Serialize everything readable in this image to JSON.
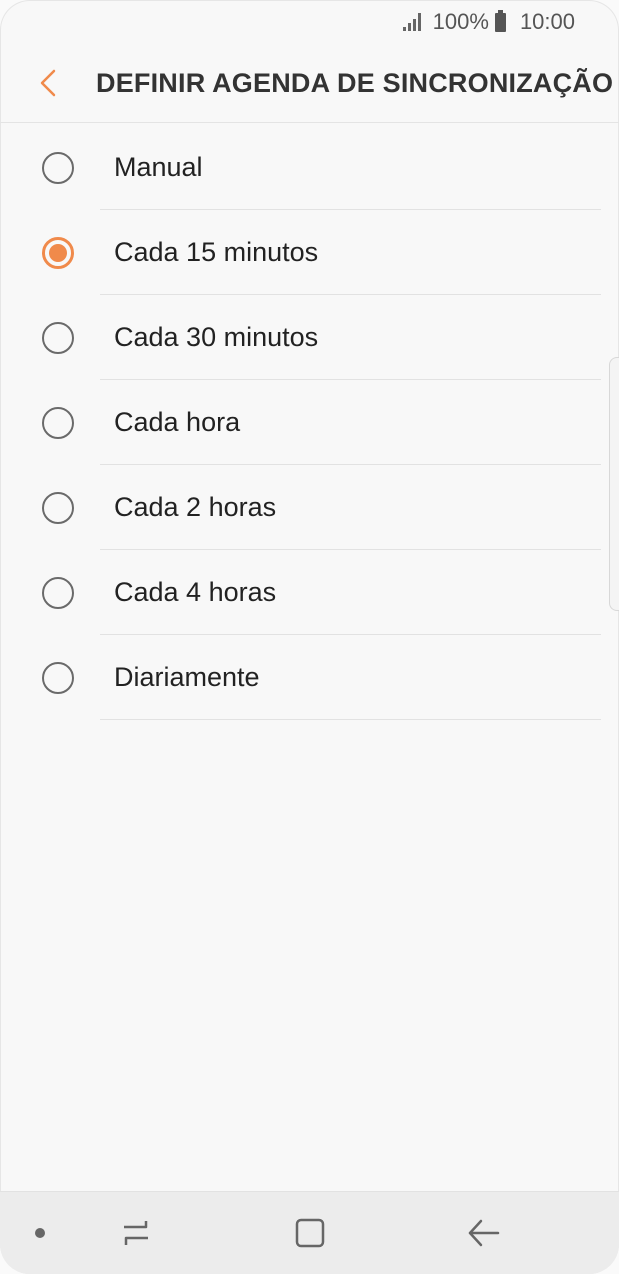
{
  "status_bar": {
    "battery_text": "100%",
    "time": "10:00",
    "icons": [
      "signal-icon",
      "battery-icon"
    ]
  },
  "header": {
    "title": "DEFINIR AGENDA DE SINCRONIZAÇÃO",
    "back_icon": "chevron-left-icon"
  },
  "options": [
    {
      "label": "Manual",
      "selected": false
    },
    {
      "label": "Cada 15 minutos",
      "selected": true
    },
    {
      "label": "Cada 30 minutos",
      "selected": false
    },
    {
      "label": "Cada hora",
      "selected": false
    },
    {
      "label": "Cada 2 horas",
      "selected": false
    },
    {
      "label": "Cada 4 horas",
      "selected": false
    },
    {
      "label": "Diariamente",
      "selected": false
    }
  ],
  "nav_bar": {
    "icons": [
      "dot-icon",
      "recents-icon",
      "home-icon",
      "back-arrow-icon"
    ]
  },
  "colors": {
    "accent": "#f08a4b",
    "background": "#f8f8f8"
  }
}
